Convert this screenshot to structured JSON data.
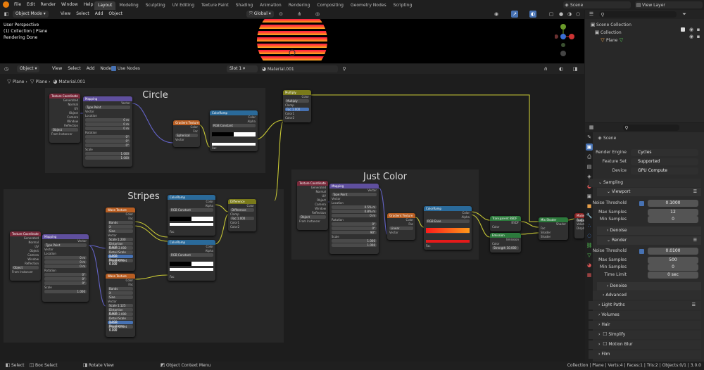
{
  "topbar": {
    "menus": [
      "File",
      "Edit",
      "Render",
      "Window",
      "Help"
    ],
    "workspaces": [
      "Layout",
      "Modeling",
      "Sculpting",
      "UV Editing",
      "Texture Paint",
      "Shading",
      "Animation",
      "Rendering",
      "Compositing",
      "Geometry Nodes",
      "Scripting"
    ],
    "active_workspace": "Layout",
    "scene": "Scene",
    "view_layer": "View Layer"
  },
  "viewport": {
    "mode": "Object Mode",
    "menus": [
      "View",
      "Select",
      "Add",
      "Object"
    ],
    "transform_orientation": "Global",
    "overlay_lines": [
      "User Perspective",
      "(1) Collection | Plane",
      "Rendering Done"
    ]
  },
  "outliner": {
    "items": [
      {
        "label": "Scene Collection"
      },
      {
        "label": "Collection"
      },
      {
        "label": "Plane"
      }
    ]
  },
  "node_editor": {
    "type": "Object",
    "menus": [
      "View",
      "Select",
      "Add",
      "Node"
    ],
    "use_nodes": "Use Nodes",
    "slot": "Slot 1",
    "material": "Material.001",
    "breadcrumb": [
      "Plane",
      "Plane",
      "Material.001"
    ],
    "frames": {
      "circle": "Circle",
      "stripes": "Stripes",
      "just_color": "Just Color"
    },
    "node_titles": {
      "tex_coord": "Texture Coordinate",
      "mapping": "Mapping",
      "gradient": "Gradient Texture",
      "color_ramp": "ColorRamp",
      "multiply": "Multiply",
      "difference": "Difference",
      "wave": "Wave Texture",
      "transparent": "Transparent BSDF",
      "emission": "Emission",
      "mix_shader": "Mix Shader",
      "output": "Material Output"
    },
    "tex_coord_outputs": [
      "Generated",
      "Normal",
      "UV",
      "Object",
      "Camera",
      "Window",
      "Reflection"
    ],
    "mapping_rows": [
      "Vector",
      "Type",
      "Point",
      "Vector",
      "Location",
      "X",
      "Y",
      "Z",
      "Rotation",
      "Scale"
    ],
    "circle_mapping_values": [
      "0 m",
      "0 m",
      "0 m",
      "0°",
      "0°",
      "0°",
      "1.000",
      "1.000",
      "1.000"
    ],
    "just_mapping_values": [
      "0.5% m",
      "0.8% m",
      "0 m",
      "0°",
      "0°",
      "90°",
      "1.000",
      "1.000",
      "1.000"
    ],
    "gradient_rows": [
      "Color",
      "Fac",
      "Spherical",
      "Vector"
    ],
    "gradient_type_circle": "Spherical",
    "gradient_type_just": "Linear",
    "ramp_rows": [
      "Color",
      "Alpha",
      "RGB",
      "Constant",
      "Fac"
    ],
    "ramp_pos_label": "Pos",
    "ramp_pos_value": "0.000",
    "ramp_index": "0",
    "ramp_mode_circle": "Constant",
    "ramp_mode_just": "Ease",
    "multiply_rows": [
      "Color",
      "Multiply",
      "Clamp",
      "Fac",
      "Color1",
      "Color2"
    ],
    "multiply_fac": "1.000",
    "difference_rows": [
      "Color",
      "Difference",
      "Clamp",
      "Fac",
      "Color1",
      "Color2"
    ],
    "difference_fac": "1.000",
    "wave_rows": [
      "Color",
      "Fac",
      "Bands",
      "X",
      "Sine",
      "Vector",
      "Scale",
      "Distortion",
      "Detail",
      "Detail Scale",
      "Detail Roughness",
      "Phase Offset"
    ],
    "wave1_values": [
      "1.200",
      "0.000",
      "2.000",
      "1.000",
      "0.500",
      "0.000"
    ],
    "wave2_values": [
      "1.125",
      "0.000",
      "2.000",
      "1.000",
      "0.500",
      "0.000"
    ],
    "transparent_rows": [
      "BSDF",
      "Color"
    ],
    "emission_rows": [
      "Emission",
      "Color",
      "Strength"
    ],
    "emission_strength": "10.000",
    "mix_rows": [
      "Shader",
      "Fac",
      "Shader",
      "Shader"
    ],
    "output_rows": [
      "All",
      "Surface",
      "Volume",
      "Displacement"
    ],
    "from_instancer": "From Instancer"
  },
  "properties": {
    "object": "Scene",
    "render_engine_label": "Render Engine",
    "render_engine": "Cycles",
    "feature_set_label": "Feature Set",
    "feature_set": "Supported",
    "device_label": "Device",
    "device": "GPU Compute",
    "sampling": "Sampling",
    "viewport": "Viewport",
    "vp_noise_label": "Noise Threshold",
    "vp_noise": "0.1000",
    "vp_max_label": "Max Samples",
    "vp_max": "12",
    "vp_min_label": "Min Samples",
    "vp_min": "0",
    "denoise": "Denoise",
    "render": "Render",
    "r_noise_label": "Noise Threshold",
    "r_noise": "0.0100",
    "r_max_label": "Max Samples",
    "r_max": "500",
    "r_min_label": "Min Samples",
    "r_min": "0",
    "time_label": "Time Limit",
    "time": "0 sec",
    "denoise2": "Denoise",
    "advanced": "Advanced",
    "panels": [
      "Light Paths",
      "Volumes",
      "Hair",
      "Simplify",
      "Motion Blur",
      "Film"
    ]
  },
  "statusbar": {
    "items": [
      "Select",
      "Box Select",
      "Rotate View",
      "Object Context Menu"
    ],
    "stats": "Collection | Plane | Verts:4 | Faces:1 | Tris:2 | Objects:0/1 | 3.0.0"
  },
  "colors": {
    "accent": "#4772b3",
    "wire": "#c9c935",
    "vec_wire": "#6363c7"
  }
}
